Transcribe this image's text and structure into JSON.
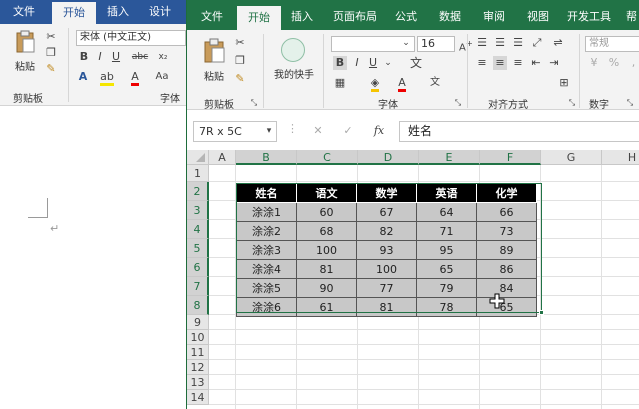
{
  "word": {
    "tabs": [
      "文件",
      "开始",
      "插入",
      "设计"
    ],
    "active_tab": "开始",
    "font_name": "宋体 (中文正文)",
    "paste_label": "粘贴",
    "group_clipboard": "剪贴板",
    "group_font": "字体",
    "paragraph_mark": "↵"
  },
  "excel": {
    "tabs": [
      "文件",
      "开始",
      "插入",
      "页面布局",
      "公式",
      "数据",
      "审阅",
      "视图",
      "开发工具",
      "帮"
    ],
    "active_tab": "开始",
    "paste_label": "粘贴",
    "quick_label": "我的快手",
    "font_size": "16",
    "number_format": "常规",
    "group_clipboard": "剪贴板",
    "group_font": "字体",
    "group_align": "对齐方式",
    "group_number": "数字",
    "name_box": "7R x 5C",
    "formula_value": "姓名",
    "fx": "fx",
    "columns": [
      "A",
      "B",
      "C",
      "D",
      "E",
      "F",
      "G",
      "H"
    ],
    "rows": [
      "1",
      "2",
      "3",
      "4",
      "5",
      "6",
      "7",
      "8",
      "9",
      "10",
      "11",
      "12",
      "13",
      "14"
    ],
    "table_header": [
      "姓名",
      "语文",
      "数学",
      "英语",
      "化学"
    ],
    "table_rows": [
      [
        "涂涂1",
        "60",
        "67",
        "64",
        "66"
      ],
      [
        "涂涂2",
        "68",
        "82",
        "71",
        "73"
      ],
      [
        "涂涂3",
        "100",
        "93",
        "95",
        "89"
      ],
      [
        "涂涂4",
        "81",
        "100",
        "65",
        "86"
      ],
      [
        "涂涂5",
        "90",
        "77",
        "79",
        "84"
      ],
      [
        "涂涂6",
        "61",
        "81",
        "78",
        "65"
      ]
    ]
  },
  "colors": {
    "excel_green": "#217346",
    "word_blue": "#2b579a"
  }
}
